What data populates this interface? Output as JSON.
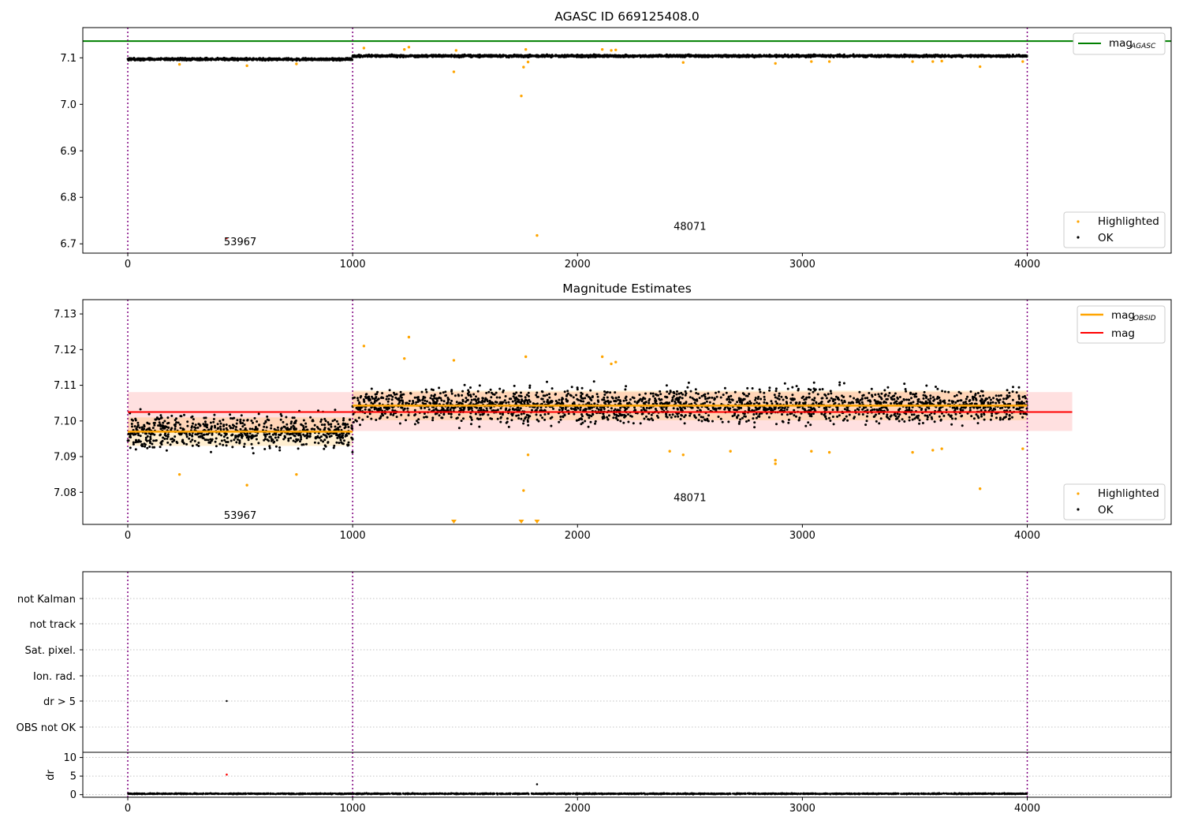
{
  "chart_data": [
    {
      "type": "scatter",
      "title": "AGASC ID 669125408.0",
      "xlim": [
        -200,
        4640
      ],
      "ylim": [
        6.68,
        7.165
      ],
      "xticks": [
        0,
        1000,
        2000,
        3000,
        4000
      ],
      "yticks": [
        6.7,
        6.8,
        6.9,
        7.0,
        7.1
      ],
      "grid": false,
      "legend_upper": {
        "placement": "top-right",
        "entries": [
          {
            "label": "mag",
            "subscript": "AGASC",
            "color": "#008000"
          }
        ]
      },
      "legend_lower": {
        "placement": "bottom-right",
        "entries": [
          {
            "label": "Highlighted",
            "color": "#ffa500"
          },
          {
            "label": "OK",
            "color": "#000000"
          }
        ]
      },
      "mag_agasc": 7.136,
      "obs_boundaries": [
        0,
        1000,
        4000
      ],
      "annotations": [
        {
          "text": "53967",
          "x": 500,
          "y": 6.697
        },
        {
          "text": "48071",
          "x": 2500,
          "y": 6.73
        }
      ],
      "ok_segments": [
        {
          "x_start": 0,
          "x_end": 1000,
          "mean": 7.097,
          "spread": 0.004
        },
        {
          "x_start": 1000,
          "x_end": 4000,
          "mean": 7.104,
          "spread": 0.004
        }
      ],
      "highlighted": [
        {
          "x": 230,
          "y": 7.086
        },
        {
          "x": 530,
          "y": 7.083
        },
        {
          "x": 750,
          "y": 7.087
        },
        {
          "x": 1050,
          "y": 7.121
        },
        {
          "x": 1230,
          "y": 7.118
        },
        {
          "x": 1250,
          "y": 7.123
        },
        {
          "x": 1450,
          "y": 7.07
        },
        {
          "x": 1460,
          "y": 7.116
        },
        {
          "x": 1750,
          "y": 7.018
        },
        {
          "x": 1760,
          "y": 7.08
        },
        {
          "x": 1770,
          "y": 7.118
        },
        {
          "x": 1780,
          "y": 7.091
        },
        {
          "x": 1820,
          "y": 6.718
        },
        {
          "x": 2110,
          "y": 7.118
        },
        {
          "x": 2150,
          "y": 7.116
        },
        {
          "x": 2170,
          "y": 7.117
        },
        {
          "x": 2470,
          "y": 7.09
        },
        {
          "x": 2880,
          "y": 7.088
        },
        {
          "x": 3040,
          "y": 7.092
        },
        {
          "x": 3120,
          "y": 7.092
        },
        {
          "x": 3490,
          "y": 7.092
        },
        {
          "x": 3580,
          "y": 7.092
        },
        {
          "x": 3620,
          "y": 7.093
        },
        {
          "x": 3790,
          "y": 7.081
        },
        {
          "x": 3980,
          "y": 7.092
        }
      ],
      "red_points": [
        {
          "x": 440,
          "y": 6.712
        }
      ]
    },
    {
      "type": "scatter",
      "title": "Magnitude Estimates",
      "xlim": [
        -200,
        4640
      ],
      "ylim": [
        7.071,
        7.134
      ],
      "xticks": [
        0,
        1000,
        2000,
        3000,
        4000
      ],
      "yticks": [
        7.08,
        7.09,
        7.1,
        7.11,
        7.12,
        7.13
      ],
      "grid": false,
      "legend_upper": {
        "placement": "top-right",
        "entries": [
          {
            "label": "mag",
            "subscript": "OBSID",
            "color": "#ffa500"
          },
          {
            "label": "mag",
            "subscript": "",
            "color": "#ff0000"
          }
        ]
      },
      "legend_lower": {
        "placement": "bottom-right",
        "entries": [
          {
            "label": "Highlighted",
            "color": "#ffa500"
          },
          {
            "label": "OK",
            "color": "#000000"
          }
        ]
      },
      "mag": 7.1025,
      "mag_band": [
        7.0972,
        7.1081
      ],
      "mag_band_x": [
        0,
        4200
      ],
      "mag_obsid": [
        {
          "x_start": 0,
          "x_end": 1000,
          "value": 7.097,
          "band": [
            7.093,
            7.101
          ]
        },
        {
          "x_start": 1000,
          "x_end": 4000,
          "value": 7.1043,
          "band": [
            7.1002,
            7.1085
          ]
        }
      ],
      "obs_boundaries": [
        0,
        1000,
        4000
      ],
      "annotations": [
        {
          "text": "53967",
          "x": 500,
          "y": 7.0725
        },
        {
          "text": "48071",
          "x": 2500,
          "y": 7.0775
        }
      ],
      "highlighted": [
        {
          "x": 230,
          "y": 7.085
        },
        {
          "x": 530,
          "y": 7.082
        },
        {
          "x": 750,
          "y": 7.085
        },
        {
          "x": 1050,
          "y": 7.121
        },
        {
          "x": 1230,
          "y": 7.1175
        },
        {
          "x": 1250,
          "y": 7.1235
        },
        {
          "x": 1450,
          "y": 7.117
        },
        {
          "x": 1760,
          "y": 7.0805
        },
        {
          "x": 1770,
          "y": 7.118
        },
        {
          "x": 1780,
          "y": 7.0905
        },
        {
          "x": 2110,
          "y": 7.118
        },
        {
          "x": 2150,
          "y": 7.116
        },
        {
          "x": 2170,
          "y": 7.1165
        },
        {
          "x": 2410,
          "y": 7.0915
        },
        {
          "x": 2470,
          "y": 7.0905
        },
        {
          "x": 2880,
          "y": 7.088
        },
        {
          "x": 2880,
          "y": 7.089
        },
        {
          "x": 2680,
          "y": 7.0915
        },
        {
          "x": 3040,
          "y": 7.0915
        },
        {
          "x": 3120,
          "y": 7.0912
        },
        {
          "x": 3490,
          "y": 7.0912
        },
        {
          "x": 3580,
          "y": 7.0918
        },
        {
          "x": 3620,
          "y": 7.0922
        },
        {
          "x": 3790,
          "y": 7.081
        },
        {
          "x": 3980,
          "y": 7.0922
        }
      ],
      "below_range_markers": [
        {
          "x": 1450
        },
        {
          "x": 1750
        },
        {
          "x": 1820
        }
      ],
      "ok_segments": [
        {
          "x_start": 0,
          "x_end": 1000,
          "mean": 7.097,
          "spread": 0.0045
        },
        {
          "x_start": 1000,
          "x_end": 4000,
          "mean": 7.1043,
          "spread": 0.0045
        }
      ]
    },
    {
      "type": "scatter",
      "title": "",
      "xlim": [
        -200,
        4640
      ],
      "categories": [
        "not Kalman",
        "not track",
        "Sat. pixel.",
        "Ion. rad.",
        "dr > 5",
        "OBS not OK"
      ],
      "grid": true,
      "obs_boundaries": [
        0,
        1000,
        4000
      ],
      "flag_points": [
        {
          "category": "dr > 5",
          "x": 440
        }
      ]
    },
    {
      "type": "scatter",
      "title": "",
      "ylabel": "dr",
      "xlim": [
        -200,
        4640
      ],
      "ylim": [
        -0.7,
        11.4
      ],
      "xticks": [
        0,
        1000,
        2000,
        3000,
        4000
      ],
      "yticks": [
        0,
        5,
        10
      ],
      "grid": true,
      "obs_boundaries": [
        0,
        1000,
        4000
      ],
      "dr_baseline": {
        "x_start": 0,
        "x_end": 4000,
        "mean": 0.25
      },
      "outliers": [
        {
          "x": 440,
          "y": 5.4,
          "color": "#ff0000"
        },
        {
          "x": 1820,
          "y": 2.8,
          "color": "#000000"
        }
      ]
    }
  ]
}
